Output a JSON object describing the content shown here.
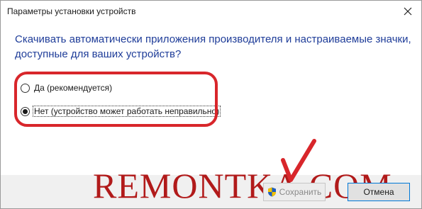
{
  "window": {
    "title": "Параметры установки устройств"
  },
  "dialog": {
    "question": "Скачивать автоматически приложения производителя и настраиваемые значки, доступные для ваших устройств?",
    "options": [
      {
        "label": "Да (рекомендуется)",
        "checked": false
      },
      {
        "label": "Нет (устройство может работать неправильно)",
        "checked": true
      }
    ]
  },
  "buttons": {
    "save_label": "Сохранить",
    "cancel_label": "Отмена"
  },
  "overlay": {
    "watermark": "REMONTKA.COM"
  },
  "colors": {
    "question_text": "#1f3d99",
    "highlight": "#d8262b",
    "watermark": "#b11a1a",
    "footer_bg": "#f0f0f0",
    "focus_border": "#0078d7"
  },
  "icons": {
    "close": "close-icon",
    "shield": "uac-shield-icon",
    "checkmark": "checkmark-icon"
  }
}
